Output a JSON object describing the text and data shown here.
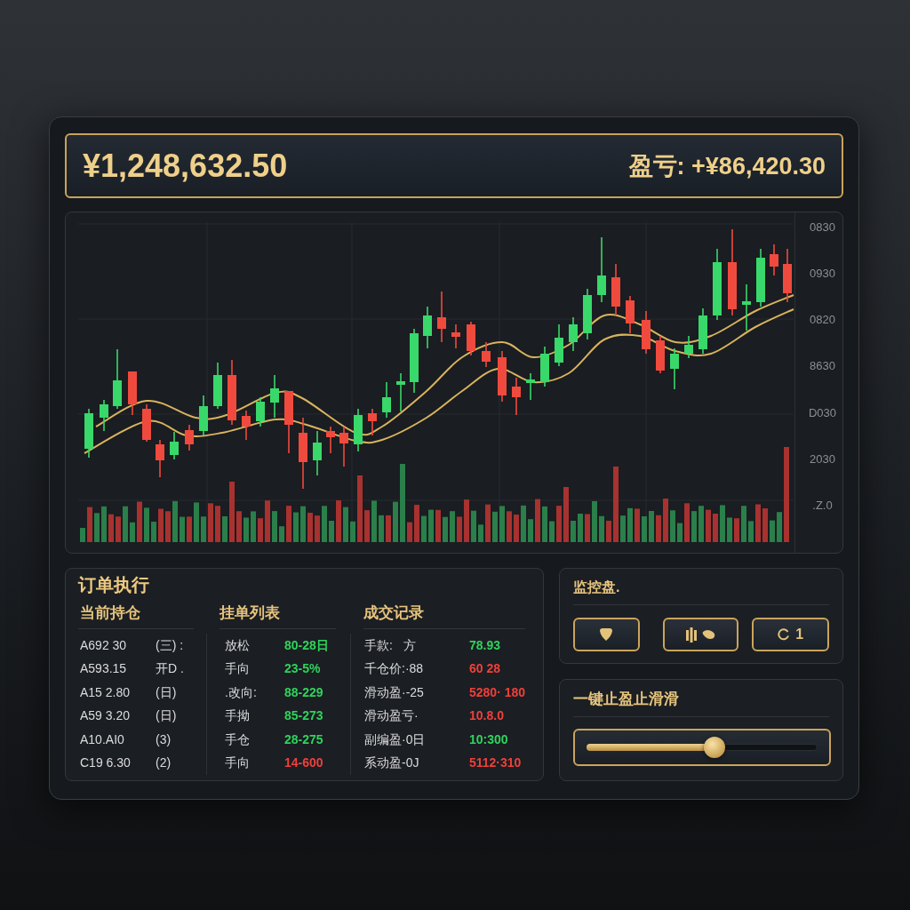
{
  "header": {
    "balance": "¥1,248,632.50",
    "profit_loss": "盈亏: +¥86,420.30"
  },
  "chart": {
    "price_axis_labels": [
      "0830",
      "0930",
      "0820",
      "8630",
      "D030",
      "2030",
      ".Z.0"
    ]
  },
  "order_panel": {
    "title": "订单执行",
    "columns": [
      {
        "heading": "当前持仓",
        "rows": [
          {
            "cells": [
              "A692 30",
              "(三) :"
            ]
          },
          {
            "cells": [
              "A593.15",
              "开D ."
            ]
          },
          {
            "cells": [
              "A15 2.80",
              "(日)"
            ]
          },
          {
            "cells": [
              "A59 3.20",
              "(日)"
            ]
          },
          {
            "cells": [
              "A10.AI0",
              "(3)"
            ]
          },
          {
            "cells": [
              "C19 6.30",
              "(2)"
            ]
          }
        ]
      },
      {
        "heading": "挂单列表",
        "rows": [
          {
            "cells": [
              "放松",
              "80-28日"
            ],
            "color": "#2fd35c"
          },
          {
            "cells": [
              "手向",
              "23-5%"
            ],
            "color": "#2fd35c"
          },
          {
            "cells": [
              ".改向:",
              "88-229"
            ],
            "color": "#2fd35c"
          },
          {
            "cells": [
              "手拗",
              "85-273"
            ],
            "color": "#2fd35c"
          },
          {
            "cells": [
              "手仓",
              "28-275"
            ],
            "color": "#2fd35c"
          },
          {
            "cells": [
              "手向",
              "14-600"
            ],
            "color": "#f0403a"
          }
        ]
      },
      {
        "heading": "成交记录",
        "rows": [
          {
            "cells": [
              "手款:   方",
              "78.93"
            ],
            "color": "#2fd35c"
          },
          {
            "cells": [
              "千仓价:·88",
              "60 28"
            ],
            "color": "#f0403a"
          },
          {
            "cells": [
              "滑动盈·-25",
              "5280· 180"
            ],
            "color": "#f0403a"
          },
          {
            "cells": [
              "滑动盈亏·",
              "10.8.0"
            ],
            "color": "#f0403a"
          },
          {
            "cells": [
              "副编盈·0日",
              "10:300"
            ],
            "color": "#2fd35c"
          },
          {
            "cells": [
              "系动盈-0J",
              "5112·310"
            ],
            "color": "#f0403a"
          }
        ]
      }
    ]
  },
  "monitor_panel": {
    "title": "监控盘.",
    "buttons": [
      {
        "kind": "icon"
      },
      {
        "kind": "icon_pair"
      },
      {
        "kind": "icon_label",
        "label": "1"
      }
    ]
  },
  "stop_panel": {
    "title": "一键止盈止滑滑",
    "slider": {
      "level": 0.56
    }
  }
}
